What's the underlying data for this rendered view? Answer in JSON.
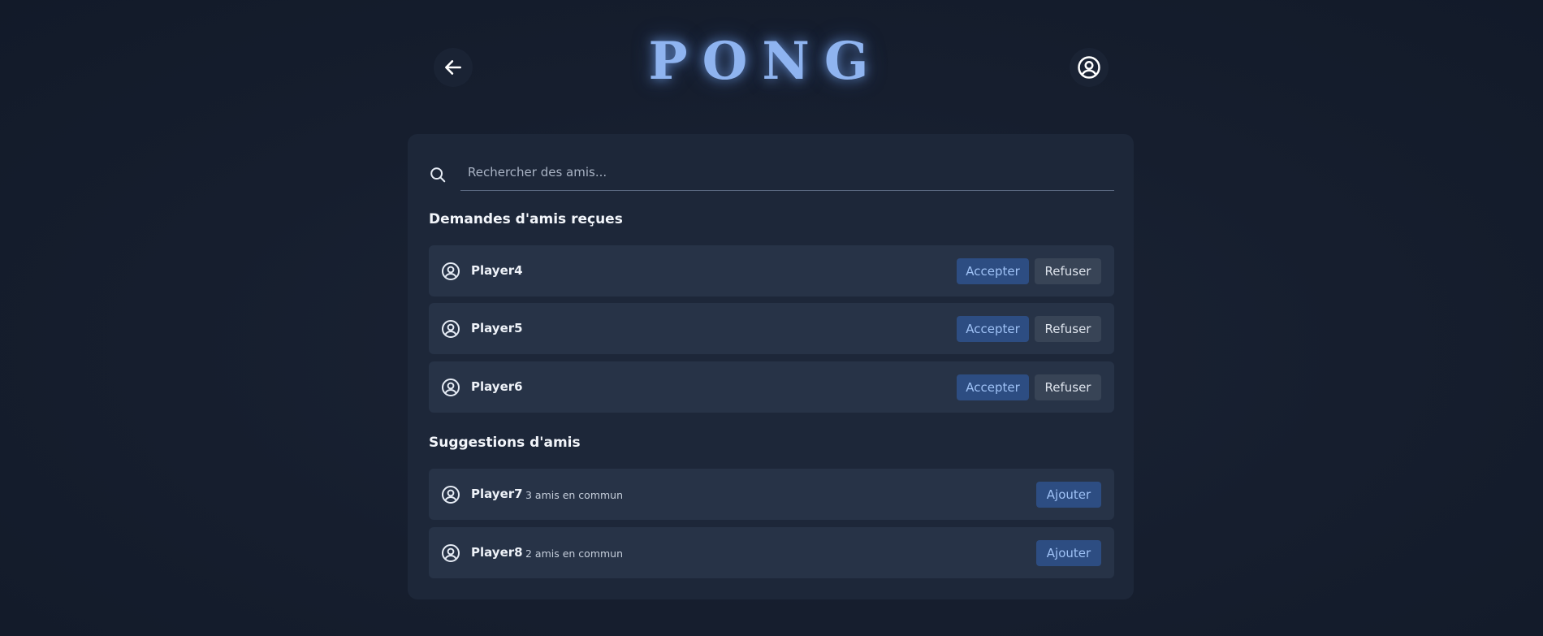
{
  "header": {
    "logo": "PONG",
    "back_icon": "arrow-left-icon",
    "profile_icon": "user-circle-icon"
  },
  "search": {
    "placeholder": "Rechercher des amis...",
    "value": "",
    "icon": "search-icon"
  },
  "requests": {
    "title": "Demandes d'amis reçues",
    "accept_label": "Accepter",
    "refuse_label": "Refuser",
    "items": [
      {
        "name": "Player4"
      },
      {
        "name": "Player5"
      },
      {
        "name": "Player6"
      }
    ]
  },
  "suggestions": {
    "title": "Suggestions d'amis",
    "add_label": "Ajouter",
    "items": [
      {
        "name": "Player7",
        "mutual": "3 amis en commun"
      },
      {
        "name": "Player8",
        "mutual": "2 amis en commun"
      }
    ]
  },
  "colors": {
    "background": "#161e2e",
    "card": "#1d2739",
    "row": "#273347",
    "accent": "#2d4d82",
    "accent_text": "#9ec1f5",
    "logo": "#8fb4f0"
  }
}
